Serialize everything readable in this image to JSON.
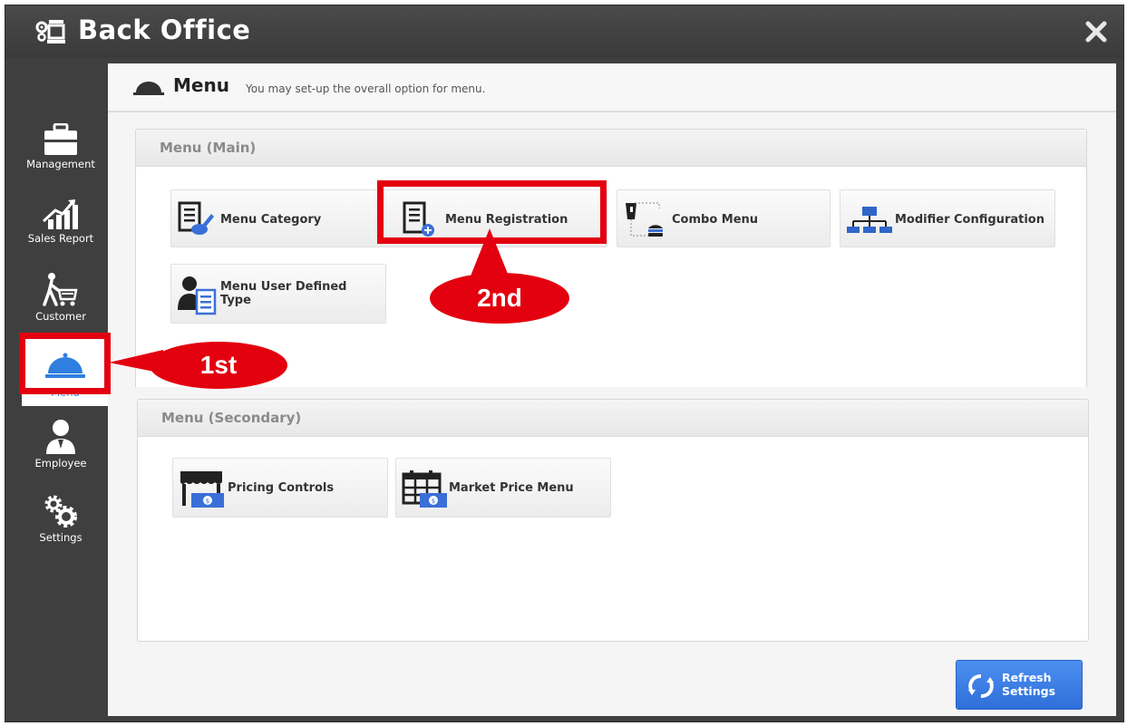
{
  "window": {
    "title": "Back Office",
    "icon": "gears-monitor-icon",
    "close_icon": "close-icon"
  },
  "sidebar": {
    "items": [
      {
        "label": "Management",
        "icon": "briefcase-icon",
        "active": false
      },
      {
        "label": "Sales Report",
        "icon": "chart-up-icon",
        "active": false
      },
      {
        "label": "Customer",
        "icon": "shopper-cart-icon",
        "active": false
      },
      {
        "label": "Menu",
        "icon": "cloche-icon",
        "active": true
      },
      {
        "label": "Employee",
        "icon": "person-icon",
        "active": false
      },
      {
        "label": "Settings",
        "icon": "gears-icon",
        "active": false
      }
    ]
  },
  "page": {
    "title": "Menu",
    "subtitle": "You may set-up the overall option for menu."
  },
  "panels": {
    "main": {
      "title": "Menu (Main)",
      "tiles": [
        {
          "label": "Menu Category",
          "icon": "document-pen-icon"
        },
        {
          "label": "Menu Registration",
          "icon": "document-add-icon"
        },
        {
          "label": "Combo Menu",
          "icon": "drink-burger-icon"
        },
        {
          "label": "Modifier Configuration",
          "icon": "hierarchy-icon"
        },
        {
          "label_line1": "Menu User Defined",
          "label_line2": "Type",
          "icon": "user-document-icon"
        }
      ]
    },
    "secondary": {
      "title": "Menu (Secondary)",
      "tiles": [
        {
          "label": "Pricing Controls",
          "icon": "store-price-icon"
        },
        {
          "label": "Market Price Menu",
          "icon": "calendar-price-icon"
        }
      ]
    }
  },
  "annotations": {
    "first": "1st",
    "second": "2nd",
    "highlight_color": "#e3000f"
  },
  "refresh": {
    "line1": "Refresh",
    "line2": "Settings",
    "icon": "refresh-icon"
  },
  "colors": {
    "titlebar": "#3f3f3f",
    "accent_blue": "#3a7fd5",
    "button_blue": "#3b7de4"
  }
}
